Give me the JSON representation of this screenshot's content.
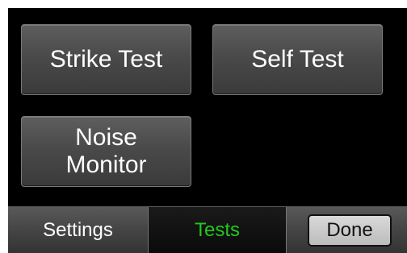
{
  "tests_screen": {
    "buttons": {
      "strike_test": "Strike Test",
      "self_test": "Self Test",
      "noise_monitor": "Noise\nMonitor"
    }
  },
  "tabbar": {
    "settings_label": "Settings",
    "tests_label": "Tests",
    "done_label": "Done"
  },
  "colors": {
    "active_tab_text": "#22c81e",
    "screen_background": "#000000",
    "button_text": "#ffffff"
  }
}
